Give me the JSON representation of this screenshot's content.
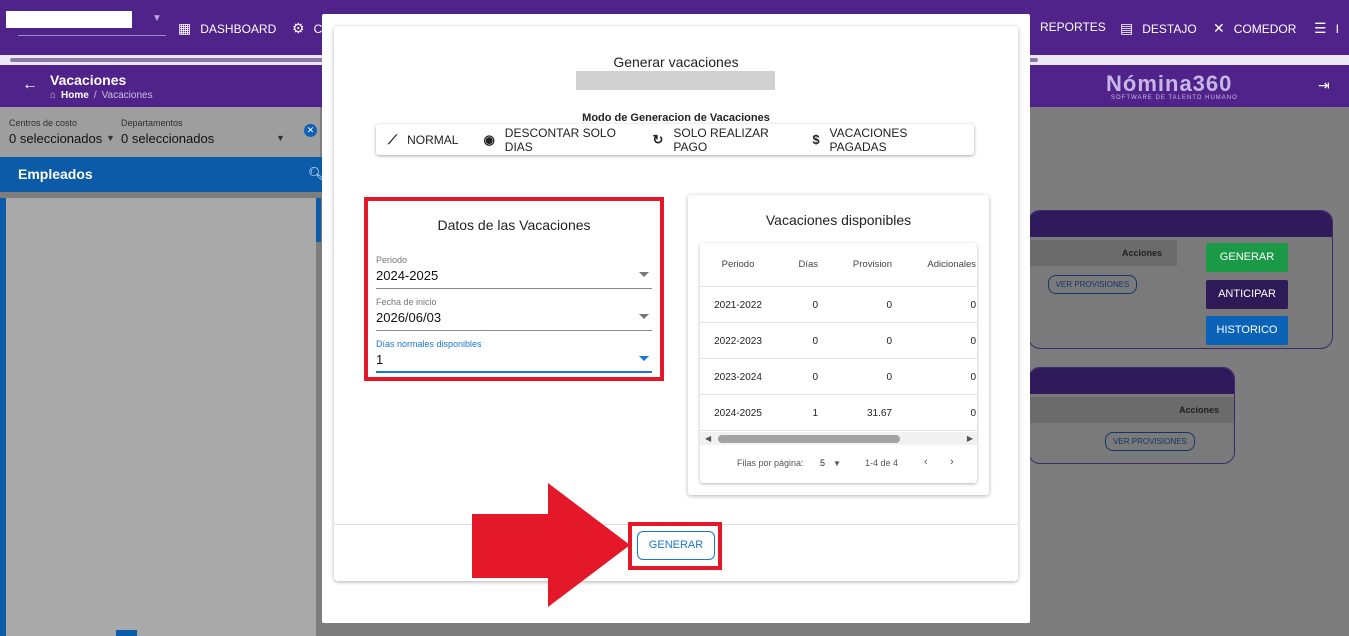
{
  "topnav": {
    "items": [
      {
        "label": "DASHBOARD",
        "icon": "dashboard-icon"
      },
      {
        "label": "C",
        "icon": "gear-icon"
      },
      {
        "label": "REPORTES",
        "icon": ""
      },
      {
        "label": "DESTAJO",
        "icon": "document-icon"
      },
      {
        "label": "COMEDOR",
        "icon": "utensils-icon"
      },
      {
        "label": "I",
        "icon": "list-icon"
      }
    ]
  },
  "titlebar": {
    "title": "Vacaciones",
    "breadcrumb_home": "Home",
    "breadcrumb_current": "Vacaciones",
    "logo": "Nómina360",
    "logo_sub": "SOFTWARE DE TALENTO HUMANO"
  },
  "filters": {
    "centros_label": "Centros de costo",
    "centros_value": "0 seleccionados",
    "departamentos_label": "Departamentos",
    "departamentos_value": "0 seleccionados"
  },
  "employees": {
    "header": "Empleados"
  },
  "background_cards": {
    "acciones_label": "Acciones",
    "ver_provisiones_label": "VER PROVISIONES",
    "buttons": {
      "generar": "GENERAR",
      "anticipar": "ANTICIPAR",
      "historico": "HISTORICO"
    }
  },
  "dialog": {
    "title": "Generar vacaciones",
    "mode_label": "Modo de Generacion de Vacaciones",
    "modes": [
      {
        "label": "NORMAL",
        "icon": "trend-icon"
      },
      {
        "label": "DESCONTAR SOLO DIAS",
        "icon": "eye-icon"
      },
      {
        "label": "SOLO REALIZAR PAGO",
        "icon": "refresh-icon"
      },
      {
        "label": "VACACIONES PAGADAS",
        "icon": "dollar-icon"
      }
    ],
    "datos": {
      "title": "Datos de las Vacaciones",
      "periodo_label": "Periodo",
      "periodo_value": "2024-2025",
      "fecha_label": "Fecha de inicio",
      "fecha_value": "2026/06/03",
      "dias_label": "Días normales disponibles",
      "dias_value": "1"
    },
    "disponibles": {
      "title": "Vacaciones disponibles",
      "columns": [
        "Periodo",
        "Días",
        "Provision",
        "Adicionales"
      ],
      "rows": [
        [
          "2021-2022",
          "0",
          "0",
          "0"
        ],
        [
          "2022-2023",
          "0",
          "0",
          "0"
        ],
        [
          "2023-2024",
          "0",
          "0",
          "0"
        ],
        [
          "2024-2025",
          "1",
          "31.67",
          "0"
        ]
      ],
      "rows_per_page_label": "Filas por página:",
      "rows_per_page": "5",
      "range": "1-4 de 4"
    },
    "generate_label": "GENERAR"
  },
  "colors": {
    "brand_purple": "#50238a",
    "annotation_red": "#e5182a",
    "accent_blue": "#1976d2"
  }
}
